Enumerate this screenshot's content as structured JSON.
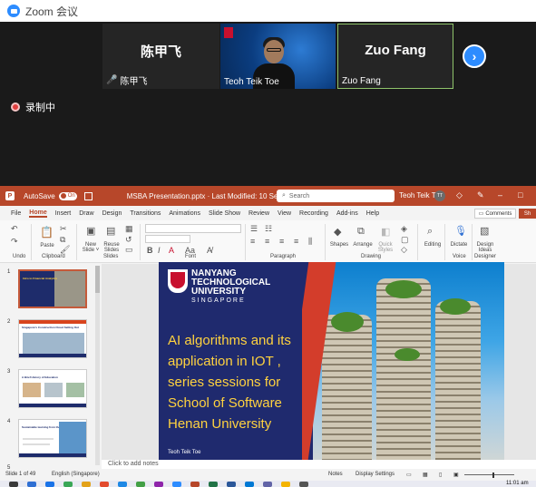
{
  "zoom": {
    "title": "Zoom 会议",
    "participants": [
      {
        "display_name": "陈甲飞",
        "label": "陈甲飞",
        "muted": true
      },
      {
        "label": "Teoh Teik Toe"
      },
      {
        "display_name": "Zuo Fang",
        "label": "Zuo Fang"
      }
    ],
    "next_icon": "chevron-right-icon",
    "recording_label": "录制中"
  },
  "ppt": {
    "app_logo": "P",
    "autosave_label": "AutoSave",
    "autosave_state": "On",
    "doc_title": "MSBA Presentation.pptx  ·  Last Modified: 10 September ˅",
    "search_placeholder": "Search",
    "user_name": "Teoh Teik Toe",
    "user_initials": "TT",
    "tabs": [
      "File",
      "Home",
      "Insert",
      "Draw",
      "Design",
      "Transitions",
      "Animations",
      "Slide Show",
      "Review",
      "View",
      "Recording",
      "Add-ins",
      "Help"
    ],
    "active_tab": "Home",
    "comments_label": "Comments",
    "share_label": "Sh",
    "ribbon": {
      "undo": "Undo",
      "clipboard": "Clipboard",
      "paste": "Paste",
      "slides": "Slides",
      "new_slide": "New Slide ˅",
      "reuse_slides": "Reuse Slides",
      "font": "Font",
      "paragraph": "Paragraph",
      "drawing": "Drawing",
      "shapes": "Shapes",
      "arrange": "Arrange",
      "quick_styles": "Quick Styles",
      "editing": "Editing",
      "voice": "Voice",
      "dictate": "Dictate",
      "designer": "Designer",
      "design_ideas": "Design Ideas"
    },
    "thumbnail_numbers": [
      "1",
      "2",
      "3",
      "4",
      "5"
    ],
    "thumbnail_titles": [
      "Intro to Financial Analytics",
      "Singapore's Construction Cloud Setting Out",
      "A Brief History of Education",
      "Sustainable learning from the Hive's Story"
    ],
    "slide": {
      "univ_line1": "NANYANG",
      "univ_line2": "TECHNOLOGICAL",
      "univ_line3": "UNIVERSITY",
      "univ_country": "SINGAPORE",
      "title_lines": [
        "AI algorithms and its",
        "application in IOT ,",
        "series sessions for",
        "School of Software",
        "Henan University"
      ],
      "author": "Teoh Teik Toe",
      "title_color": "#ffd23f",
      "bg_color": "#1f2a6e",
      "accent_color": "#d33d2b"
    },
    "notes_placeholder": "Click to add notes",
    "status": {
      "slide_count": "Slide 1 of 49",
      "language": "English (Singapore)",
      "notes": "Notes",
      "display_settings": "Display Settings"
    }
  },
  "taskbar": {
    "time": "11:01 am"
  }
}
